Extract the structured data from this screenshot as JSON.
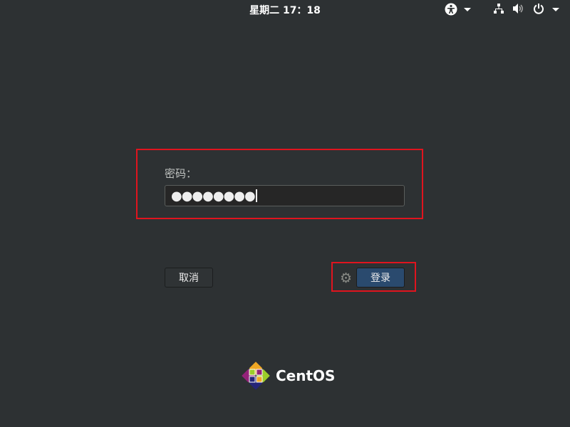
{
  "topbar": {
    "clock": "星期二 17：18",
    "icons": [
      "accessibility-icon",
      "network-icon",
      "volume-icon",
      "power-icon"
    ]
  },
  "login": {
    "password_label": "密码：",
    "password_value": "●●●●●●●●",
    "cancel_label": "取消",
    "login_label": "登录",
    "settings_icon": "gear-icon"
  },
  "brand": {
    "name": "CentOS"
  },
  "colors": {
    "background": "#2d3133",
    "login_button": "#2a4a6e",
    "highlight": "#e0141e"
  }
}
